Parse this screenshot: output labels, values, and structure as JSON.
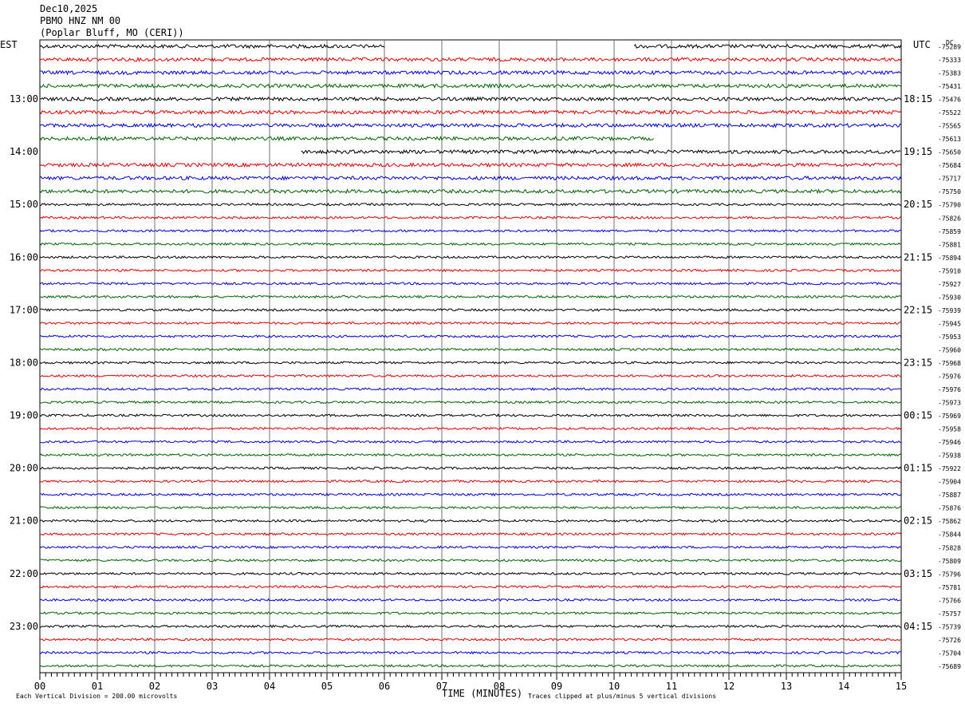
{
  "header": {
    "date": "Dec10,2025",
    "station": "PBMO HNZ NM 00",
    "location": "(Poplar Bluff, MO (CERI))"
  },
  "chart_data": {
    "type": "line",
    "left_label": "EST",
    "right_label": "UTC",
    "dc_label": "DC",
    "xlabel": "TIME (MINUTES)",
    "xlim": [
      0,
      15
    ],
    "x_ticks": [
      "00",
      "01",
      "02",
      "03",
      "04",
      "05",
      "06",
      "07",
      "08",
      "09",
      "10",
      "11",
      "12",
      "13",
      "14",
      "15"
    ],
    "left_hour_labels": [
      "13:00",
      "14:00",
      "15:00",
      "16:00",
      "17:00",
      "18:00",
      "19:00",
      "20:00",
      "21:00",
      "22:00",
      "23:00"
    ],
    "right_hour_labels": [
      "18:15",
      "19:15",
      "20:15",
      "21:15",
      "22:15",
      "23:15",
      "00:15",
      "01:15",
      "02:15",
      "03:15",
      "04:15"
    ],
    "trace_colors": [
      "#000000",
      "#e00000",
      "#0000e0",
      "#006400"
    ],
    "dc_offsets": [
      "-75289",
      "-75333",
      "-75383",
      "-75431",
      "-75476",
      "-75522",
      "-75565",
      "-75613",
      "-75650",
      "-75684",
      "-75717",
      "-75750",
      "-75790",
      "-75826",
      "-75859",
      "-75881",
      "-75894",
      "-75910",
      "-75927",
      "-75930",
      "-75939",
      "-75945",
      "-75953",
      "-75960",
      "-75968",
      "-75976",
      "-75976",
      "-75973",
      "-75969",
      "-75958",
      "-75946",
      "-75938",
      "-75922",
      "-75904",
      "-75887",
      "-75876",
      "-75862",
      "-75844",
      "-75828",
      "-75809",
      "-75796",
      "-75781",
      "-75766",
      "-75757",
      "-75739",
      "-75726",
      "-75704",
      "-75689"
    ],
    "footer_left": "Each Vertical Division =  200.00 microvolts",
    "footer_right": "Traces clipped at plus/minus 5 vertical divisions",
    "gaps": [
      {
        "trace": 0,
        "start_min": 6.0,
        "end_min": 10.35
      },
      {
        "trace": 7,
        "start_min": 10.7,
        "end_min": 15
      },
      {
        "trace": 8,
        "start_min": 0,
        "end_min": 4.55
      }
    ]
  }
}
